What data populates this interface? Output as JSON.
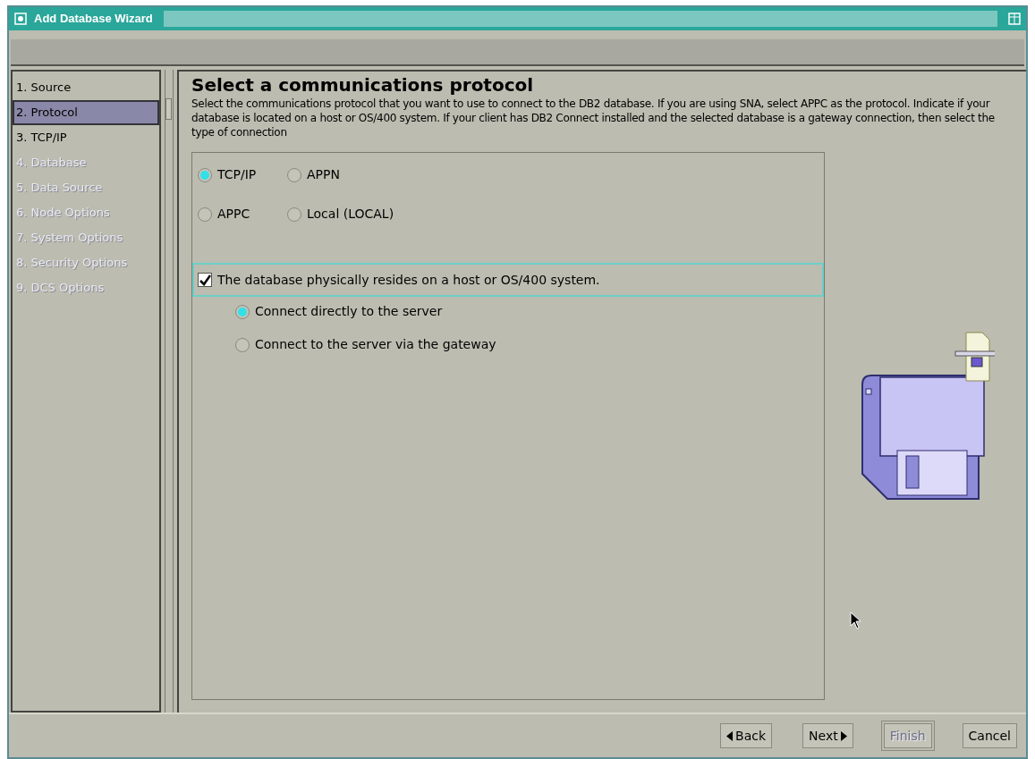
{
  "window": {
    "title": "Add Database Wizard"
  },
  "steps": [
    {
      "label": "1. Source",
      "selected": false,
      "disabled": false
    },
    {
      "label": "2. Protocol",
      "selected": true,
      "disabled": false
    },
    {
      "label": "3. TCP/IP",
      "selected": false,
      "disabled": false
    },
    {
      "label": "4. Database",
      "selected": false,
      "disabled": true
    },
    {
      "label": "5. Data Source",
      "selected": false,
      "disabled": true
    },
    {
      "label": "6. Node Options",
      "selected": false,
      "disabled": true
    },
    {
      "label": "7. System Options",
      "selected": false,
      "disabled": true
    },
    {
      "label": "8. Security Options",
      "selected": false,
      "disabled": true
    },
    {
      "label": "9. DCS Options",
      "selected": false,
      "disabled": true
    }
  ],
  "heading": "Select a communications protocol",
  "description": "Select the communications protocol that you want to use to connect to the DB2 database. If you are using SNA, select APPC as the protocol. Indicate if your database is located on a host or OS/400 system. If your client has DB2 Connect installed and the selected database is a gateway connection, then select the type of connection",
  "protocols": [
    {
      "label": "TCP/IP",
      "selected": true
    },
    {
      "label": "APPN",
      "selected": false
    },
    {
      "label": "APPC",
      "selected": false
    },
    {
      "label": "Local (LOCAL)",
      "selected": false
    }
  ],
  "host_option": {
    "label": "The database physically resides on a host or OS/400 system.",
    "checked": true
  },
  "connection_types": [
    {
      "label": "Connect directly to the server",
      "selected": true
    },
    {
      "label": "Connect to the server via the gateway",
      "selected": false
    }
  ],
  "buttons": [
    {
      "label": "Back",
      "kind": "back",
      "disabled": false
    },
    {
      "label": "Next",
      "kind": "next",
      "disabled": false
    },
    {
      "label": "Finish",
      "kind": "plain",
      "disabled": true
    },
    {
      "label": "Cancel",
      "kind": "plain",
      "disabled": false
    }
  ]
}
